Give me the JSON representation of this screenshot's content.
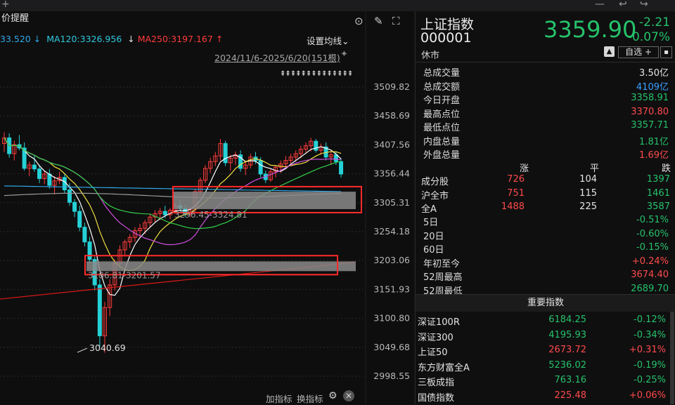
{
  "app": {
    "title_fragment": "价提醒"
  },
  "chart_header": {
    "ma60_fragment": "33.520",
    "ma120_label": "MA120:3326.956",
    "ma120_arrow": "↓",
    "ma250_label": "MA250:3197.167",
    "ma250_arrow": "↑",
    "ma60_arrow": "↓",
    "settings_label": "设置均线",
    "settings_arrow": "⌄",
    "date_range": "2024/11/6-2025/6/20(151根)",
    "marker_row": "⇞⇞⇞⇞⇞⇞⇞⇞⇞⇞⇞⇞⇞⇞"
  },
  "chart_data": {
    "type": "candlestick",
    "title": "",
    "y_ticks": [
      "3509.82",
      "3458.69",
      "3407.56",
      "3356.44",
      "3305.31",
      "3254.18",
      "3203.06",
      "3151.93",
      "3100.80",
      "3049.68",
      "2998.55"
    ],
    "ylim": [
      2998.55,
      3509.82
    ],
    "low_label": "3040.69",
    "zone_upper_label": "3296.45-3324.81",
    "zone_lower_label": "3186.81-3201.57",
    "colors": {
      "up": "#ff3b3b",
      "down": "#25d0d6",
      "ma5": "#ffffff",
      "ma10": "#f0e040",
      "ma20": "#d050e0",
      "ma30": "#33d04a",
      "ma60": "#30a8e8",
      "ma120": "#9a9a9a",
      "ma250": "#e01818"
    }
  },
  "footer": {
    "add_indicator": "加指标",
    "switch_indicator": "换指标",
    "gear_icon": "⚙",
    "close_icon": "✕"
  },
  "quote": {
    "name": "上证指数",
    "code": "000001",
    "status": "休市",
    "price": "3359.90",
    "change": "-2.21",
    "change_pct": "-0.07%",
    "bell_icon": "🔔",
    "watchlist_label": "自选 +",
    "more_icon": "▪"
  },
  "stats": [
    {
      "k": "总成交量",
      "v": "3.50亿",
      "c": "white"
    },
    {
      "k": "总成交额",
      "v": "4109亿",
      "c": "blue"
    },
    {
      "k": "今日开盘",
      "v": "3358.91",
      "c": "green"
    },
    {
      "k": "最高点位",
      "v": "3370.80",
      "c": "red"
    },
    {
      "k": "最低点位",
      "v": "3357.71",
      "c": "green"
    },
    {
      "k": "内盘总量",
      "v": "1.81亿",
      "c": "green"
    },
    {
      "k": "外盘总量",
      "v": "1.69亿",
      "c": "red"
    }
  ],
  "breadth": {
    "headers": [
      "涨",
      "平",
      "跌"
    ],
    "rows": [
      {
        "name": "成分股",
        "up": "726",
        "flat": "104",
        "down": "1397"
      },
      {
        "name": "沪全市",
        "up": "751",
        "flat": "115",
        "down": "1461"
      },
      {
        "name": "全A",
        "up": "1488",
        "flat": "225",
        "down": "3587"
      }
    ]
  },
  "periods": [
    {
      "k": "5日",
      "v": "-0.51%",
      "c": "green"
    },
    {
      "k": "20日",
      "v": "-0.60%",
      "c": "green"
    },
    {
      "k": "60日",
      "v": "-0.15%",
      "c": "green"
    },
    {
      "k": "年初至今",
      "v": "+0.24%",
      "c": "red"
    },
    {
      "k": "52周最高",
      "v": "3674.40",
      "c": "red"
    },
    {
      "k": "52周最低",
      "v": "2689.70",
      "c": "green"
    }
  ],
  "major_indices": {
    "title": "重要指数",
    "rows": [
      {
        "name": "深证100R",
        "price": "6184.25",
        "pct": "-0.12%",
        "c": "green"
      },
      {
        "name": "深证300",
        "price": "4195.93",
        "pct": "-0.34%",
        "c": "green"
      },
      {
        "name": "上证50",
        "price": "2673.72",
        "pct": "+0.31%",
        "c": "red"
      },
      {
        "name": "东方财富全A",
        "price": "5236.02",
        "pct": "-0.19%",
        "c": "green"
      },
      {
        "name": "三板成指",
        "price": "763.16",
        "pct": "-0.25%",
        "c": "green"
      },
      {
        "name": "国债指数",
        "price": "225.48",
        "pct": "+0.06%",
        "c": "red"
      }
    ]
  }
}
